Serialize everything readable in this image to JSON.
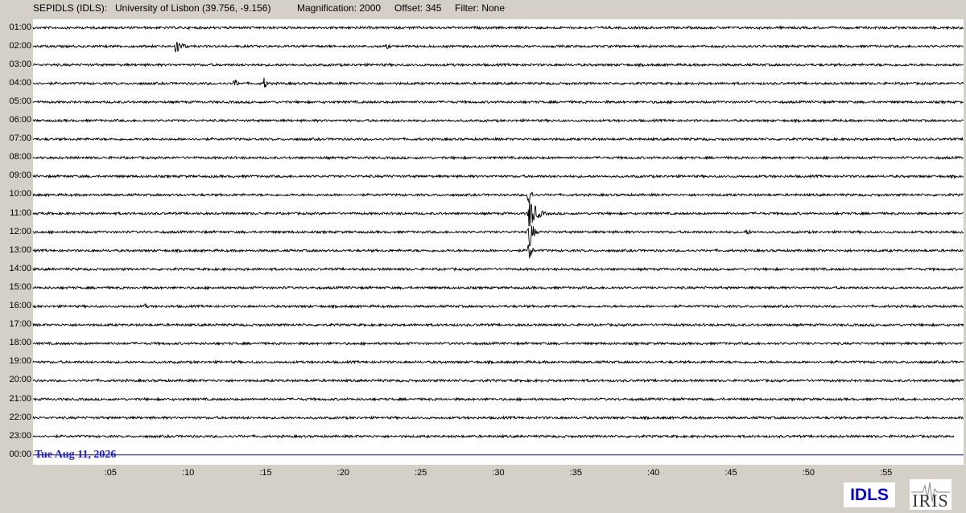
{
  "header": {
    "station": "SEPIDLS (IDLS):",
    "location": "University of Lisbon (39.756, -9.156)",
    "magnification": "Magnification: 2000",
    "offset": "Offset: 345",
    "filter": "Filter: None"
  },
  "chart_data": {
    "type": "line",
    "title": "",
    "xlabel": "",
    "ylabel": "",
    "x_unit": "minutes past the hour",
    "xlim": [
      0,
      60
    ],
    "x_ticks": [
      ":05",
      ":10",
      ":15",
      ":20",
      ":25",
      ":30",
      ":35",
      ":40",
      ":45",
      ":50",
      ":55"
    ],
    "x_tick_values": [
      5,
      10,
      15,
      20,
      25,
      30,
      35,
      40,
      45,
      50,
      55
    ],
    "hour_labels": [
      "01:00",
      "02:00",
      "03:00",
      "04:00",
      "05:00",
      "06:00",
      "07:00",
      "08:00",
      "09:00",
      "10:00",
      "11:00",
      "12:00",
      "13:00",
      "14:00",
      "15:00",
      "16:00",
      "17:00",
      "18:00",
      "19:00",
      "20:00",
      "21:00",
      "22:00",
      "23:00",
      "00:00"
    ],
    "date_label": "Tue Aug 11, 2026",
    "trace_color": "#000000",
    "current_trace_color": "#0000ff",
    "last_data_minute": 59.4,
    "events": [
      {
        "hour": "02:00",
        "minute": 9.2,
        "amplitude": 10,
        "duration": 1.0
      },
      {
        "hour": "02:00",
        "minute": 22.8,
        "amplitude": 4,
        "duration": 0.6
      },
      {
        "hour": "04:00",
        "minute": 13.0,
        "amplitude": 6,
        "duration": 0.7
      },
      {
        "hour": "04:00",
        "minute": 14.9,
        "amplitude": 8,
        "duration": 0.5
      },
      {
        "hour": "05:00",
        "minute": 40.3,
        "amplitude": 3,
        "duration": 0.5
      },
      {
        "hour": "09:00",
        "minute": 22.8,
        "amplitude": 3,
        "duration": 0.5
      },
      {
        "hour": "10:00",
        "minute": 32.0,
        "amplitude": 30,
        "duration": 0.2
      },
      {
        "hour": "11:00",
        "minute": 32.0,
        "amplitude": 22,
        "duration": 1.0
      },
      {
        "hour": "12:00",
        "minute": 32.0,
        "amplitude": 25,
        "duration": 0.5
      },
      {
        "hour": "12:00",
        "minute": 46.0,
        "amplitude": 4,
        "duration": 0.8
      },
      {
        "hour": "13:00",
        "minute": 32.0,
        "amplitude": 18,
        "duration": 0.3
      },
      {
        "hour": "16:00",
        "minute": 7.2,
        "amplitude": 4,
        "duration": 0.6
      }
    ]
  },
  "logos": {
    "idls": "IDLS",
    "iris": "IRIS"
  }
}
